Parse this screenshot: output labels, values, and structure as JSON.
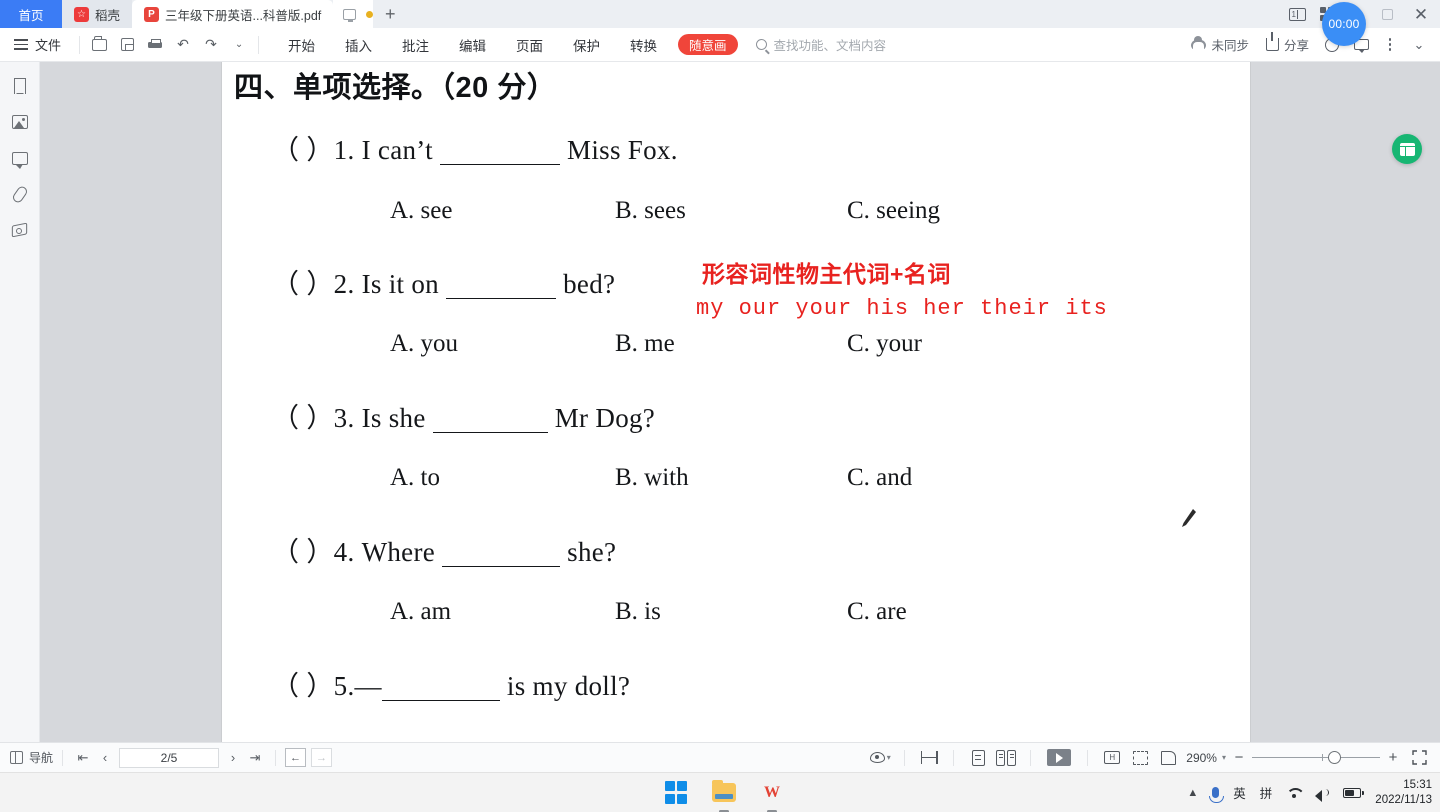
{
  "window": {
    "tabs": [
      {
        "label": "首页",
        "icon": "home-icon",
        "state": "home"
      },
      {
        "label": "稻壳",
        "icon": "docer-icon",
        "state": "inactive"
      },
      {
        "label": "三年级下册英语...科普版.pdf",
        "icon": "pdf-icon",
        "state": "active"
      }
    ],
    "tab_extra": {
      "monitor_icon": "monitor-icon",
      "unsaved_dot": "unsaved-dot-icon",
      "new_tab_label": "+"
    },
    "controls": {
      "page_mode_icon": "page-mode-icon",
      "apps_grid_icon": "apps-grid-icon",
      "minimize_label": "—",
      "maximize_icon": "maximize-icon",
      "close_label": "✕"
    },
    "timer": {
      "value": "00:00"
    }
  },
  "ribbon": {
    "file_label": "文件",
    "quick_icons": [
      "open-folder-icon",
      "save-icon",
      "print-icon",
      "undo-icon",
      "redo-icon",
      "more-icon"
    ],
    "tabs": [
      "开始",
      "插入",
      "批注",
      "编辑",
      "页面",
      "保护",
      "转换"
    ],
    "pill_label": "随意画",
    "search_placeholder": "查找功能、文档内容",
    "right": {
      "sync_label": "未同步",
      "share_label": "分享",
      "smiley_icon": "smiley-icon",
      "chat_icon": "chat-icon",
      "more_icon": "kebab-icon",
      "collapse_icon": "chevron-down-icon"
    }
  },
  "sidebar": {
    "items": [
      {
        "name": "bookmark",
        "icon": "bookmark-icon"
      },
      {
        "name": "thumbnail",
        "icon": "image-icon"
      },
      {
        "name": "comment",
        "icon": "comment-icon"
      },
      {
        "name": "attachment",
        "icon": "paperclip-icon"
      },
      {
        "name": "signature",
        "icon": "stamp-icon"
      }
    ]
  },
  "document": {
    "heading": "四、单项选择。（20 分）",
    "questions": [
      {
        "paren": "（      ）",
        "number": "1.",
        "text_before": "I can’t",
        "blank_width": 120,
        "text_after": "Miss Fox.",
        "options": [
          "A. see",
          "B. sees",
          "C. seeing"
        ]
      },
      {
        "paren": "（      ）",
        "number": "2.",
        "text_before": "Is it on",
        "blank_width": 110,
        "text_after": "bed?",
        "options": [
          "A. you",
          "B. me",
          "C. your"
        ]
      },
      {
        "paren": "（      ）",
        "number": "3.",
        "text_before": "Is she",
        "blank_width": 115,
        "text_after": "Mr Dog?",
        "options": [
          "A. to",
          "B. with",
          "C. and"
        ]
      },
      {
        "paren": "（      ）",
        "number": "4.",
        "text_before": "Where",
        "blank_width": 118,
        "text_after": "she?",
        "options": [
          "A. am",
          "B. is",
          "C. are"
        ]
      },
      {
        "paren": "（      ）",
        "number": "5.",
        "text_before": "—",
        "blank_width": 118,
        "text_after": "is my doll?",
        "options": []
      }
    ],
    "annotations": {
      "chinese": "形容词性物主代词+名词",
      "english": "my our your his her their its",
      "color": "#e8221f"
    },
    "cursor_icon": "pen-cursor-icon",
    "extract_button_icon": "extract-table-icon"
  },
  "statusbar": {
    "nav_label": "导航",
    "first_page_icon": "first-page-icon",
    "prev_page_icon": "prev-page-icon",
    "page_value": "2/5",
    "next_page_icon": "next-page-icon",
    "last_page_icon": "last-page-icon",
    "back_icon": "back-view-icon",
    "forward_icon": "forward-view-icon",
    "view_icon": "eye-icon",
    "split_icon": "split-view-icon",
    "single_page_icon": "single-page-icon",
    "two_page_icon": "two-page-icon",
    "play_icon": "presentation-icon",
    "fit_width_icon": "fit-width-icon",
    "crop_icon": "crop-icon",
    "fit_page_icon": "fit-page-icon",
    "zoom_value": "290%",
    "zoom_out_label": "−",
    "zoom_in_label": "+",
    "fullscreen_icon": "fullscreen-icon"
  },
  "taskbar": {
    "apps": [
      {
        "name": "start",
        "icon": "windows-logo-icon"
      },
      {
        "name": "file-explorer",
        "icon": "folder-icon"
      },
      {
        "name": "wps-office",
        "icon": "wps-icon",
        "glyph": "W"
      }
    ],
    "tray": {
      "overflow_icon": "chevron-up-icon",
      "mic_icon": "microphone-icon",
      "ime_lang": "英",
      "ime_mode": "拼",
      "wifi_icon": "wifi-icon",
      "volume_icon": "volume-icon",
      "battery_icon": "battery-icon",
      "time": "15:31",
      "date": "2022/11/13"
    }
  }
}
